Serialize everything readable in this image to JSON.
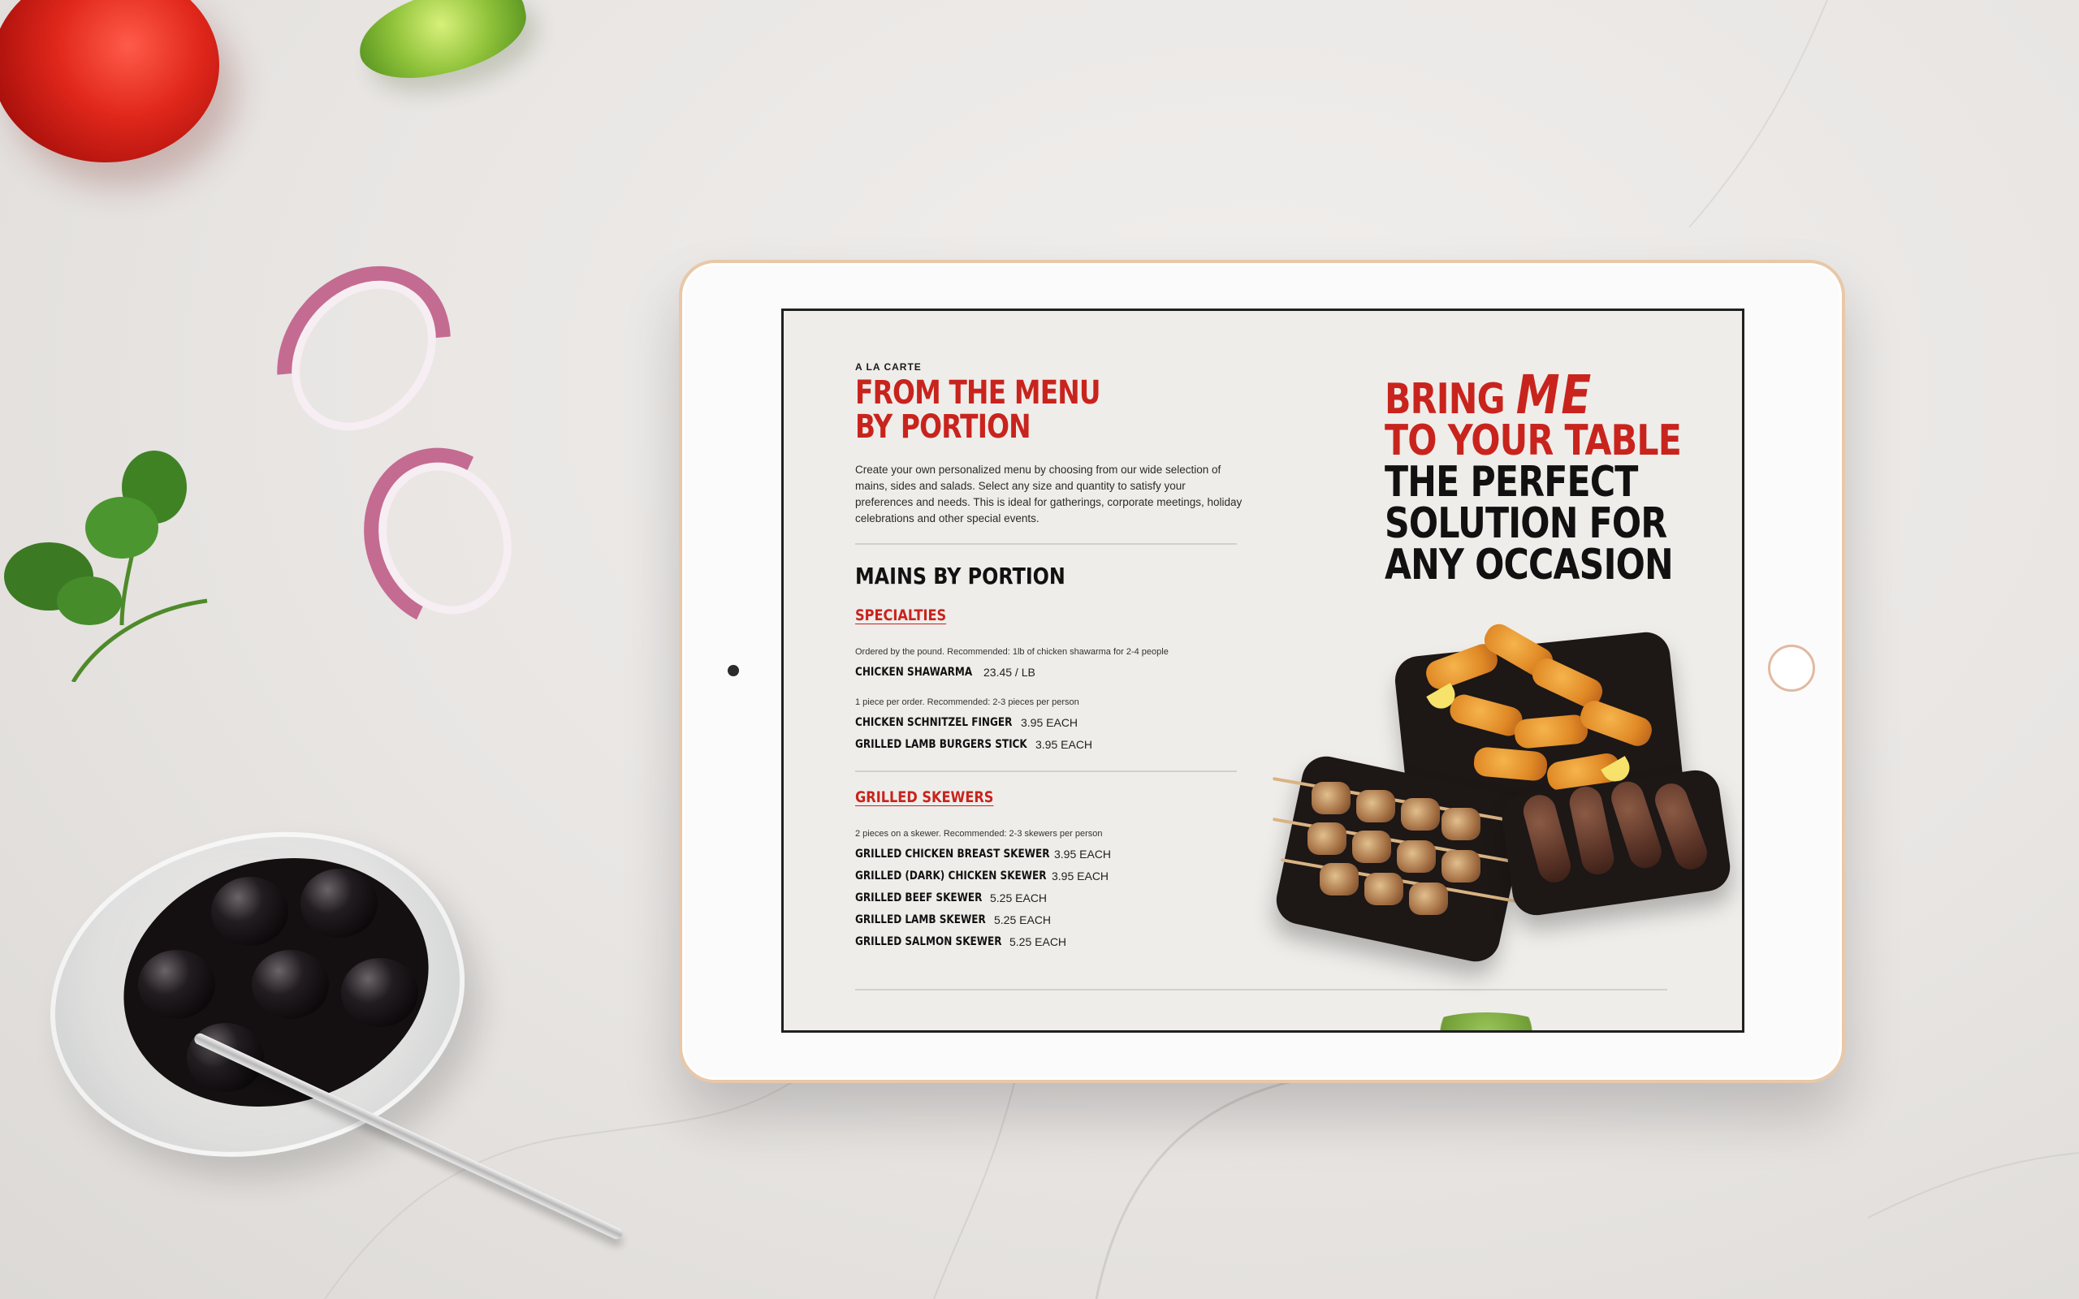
{
  "menu": {
    "kicker": "A LA CARTE",
    "title_line1": "FROM THE MENU",
    "title_line2": "BY PORTION",
    "intro": "Create your own personalized menu by choosing from our wide selection of mains, sides and salads. Select any size and quantity to satisfy your preferences and needs. This is ideal for gatherings, corporate meetings, holiday celebrations and other special events.",
    "section_title": "MAINS BY PORTION",
    "categories": [
      {
        "title": "SPECIALTIES",
        "groups": [
          {
            "note": "Ordered by the pound. Recommended: 1lb of chicken shawarma for 2-4 people",
            "items": [
              {
                "name": "CHICKEN SHAWARMA",
                "price": "23.45 / LB"
              }
            ]
          },
          {
            "note": "1 piece per order. Recommended: 2-3 pieces per person",
            "items": [
              {
                "name": "CHICKEN SCHNITZEL FINGER",
                "price": "3.95 EACH"
              },
              {
                "name": "GRILLED LAMB BURGERS STICK",
                "price": "3.95 EACH"
              }
            ]
          }
        ]
      },
      {
        "title": "GRILLED SKEWERS",
        "groups": [
          {
            "note": "2 pieces on a skewer. Recommended: 2-3 skewers per person",
            "items": [
              {
                "name": "GRILLED CHICKEN BREAST SKEWER",
                "price": "3.95 EACH"
              },
              {
                "name": "GRILLED (DARK) CHICKEN SKEWER",
                "price": "3.95 EACH"
              },
              {
                "name": "GRILLED BEEF SKEWER",
                "price": "5.25 EACH"
              },
              {
                "name": "GRILLED LAMB SKEWER",
                "price": "5.25 EACH"
              },
              {
                "name": "GRILLED SALMON SKEWER",
                "price": "5.25 EACH"
              }
            ]
          }
        ]
      }
    ]
  },
  "promo": {
    "line1_prefix": "BRING ",
    "line1_emphasis": "ME",
    "line2": "TO YOUR TABLE",
    "line3": "THE PERFECT",
    "line4": "SOLUTION FOR",
    "line5": "ANY OCCASION"
  },
  "colors": {
    "accent_red": "#c8241d",
    "text_dark": "#111111",
    "screen_bg": "#efedea"
  }
}
